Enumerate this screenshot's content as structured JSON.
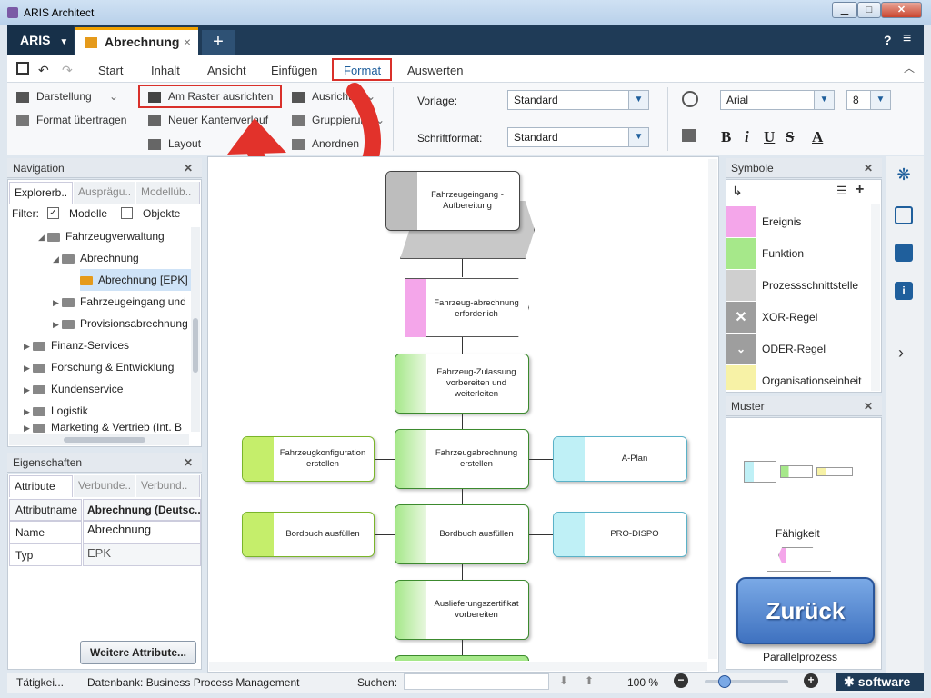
{
  "window": {
    "title": "ARIS Architect"
  },
  "appbar": {
    "aris": "ARIS",
    "tab": "Abrechnung",
    "close": "×",
    "plus": "+",
    "help": "?",
    "menu": "≡"
  },
  "menubar": {
    "items": [
      "Start",
      "Inhalt",
      "Ansicht",
      "Einfügen",
      "Format",
      "Auswerten"
    ]
  },
  "ribbon": {
    "darstellung": "Darstellung",
    "format_uebertragen": "Format übertragen",
    "am_raster": "Am Raster ausrichten",
    "neuer_kanten": "Neuer Kantenverlauf",
    "layout": "Layout",
    "ausrichten": "Ausrichten",
    "gruppierung": "Gruppierung",
    "anordnen": "Anordnen",
    "vorlage_label": "Vorlage:",
    "vorlage_value": "Standard",
    "schriftformat_label": "Schriftformat:",
    "schriftformat_value": "Standard",
    "font": "Arial",
    "size": "8",
    "bold": "B",
    "italic": "i",
    "underline": "U",
    "strike": "S",
    "color": "A"
  },
  "navigation": {
    "title": "Navigation",
    "tabs": [
      "Explorerb..",
      "Ausprägu..",
      "Modellüb.."
    ],
    "filter_label": "Filter:",
    "filter_modelle": "Modelle",
    "filter_objekte": "Objekte",
    "tree": [
      "Fahrzeugverwaltung",
      "Abrechnung",
      "Abrechnung [EPK]",
      "Fahrzeugeingang und",
      "Provisionsabrechnung",
      "Finanz-Services",
      "Forschung & Entwicklung",
      "Kundenservice",
      "Logistik",
      "Marketing & Vertrieb (Int. B"
    ]
  },
  "properties": {
    "title": "Eigenschaften",
    "tabs": [
      "Attribute",
      "Verbunde..",
      "Verbund.."
    ],
    "col1": "Attributname",
    "col2": "Abrechnung (Deutsc...",
    "rows": [
      {
        "k": "Name",
        "v": "Abrechnung"
      },
      {
        "k": "Typ",
        "v": "EPK"
      }
    ],
    "more": "Weitere Attribute..."
  },
  "diagram": {
    "n1": "Fahrzeugeingang - Aufbereitung",
    "n2": "Fahrzeug-abrechnung erforderlich",
    "n3": "Fahrzeug-Zulassung vorbereiten und weiterleiten",
    "n4": "Fahrzeugabrechnung erstellen",
    "n5": "Fahrzeugkonfiguration erstellen",
    "n6": "A-Plan",
    "n7": "Bordbuch ausfüllen",
    "n8": "Bordbuch ausfüllen",
    "n9": "PRO-DISPO",
    "n10": "Auslieferungszertifikat vorbereiten"
  },
  "symbols": {
    "title": "Symbole",
    "items": [
      "Ereignis",
      "Funktion",
      "Prozessschnittstelle",
      "XOR-Regel",
      "ODER-Regel",
      "Organisationseinheit"
    ]
  },
  "muster": {
    "title": "Muster",
    "faehigkeit": "Fähigkeit",
    "parallel": "Parallelprozess",
    "zurueck": "Zurück"
  },
  "status": {
    "left": "Tätigkei...",
    "db": "Datenbank: Business Process Management",
    "search": "Suchen:",
    "zoom": "100 %",
    "brand": "software"
  }
}
